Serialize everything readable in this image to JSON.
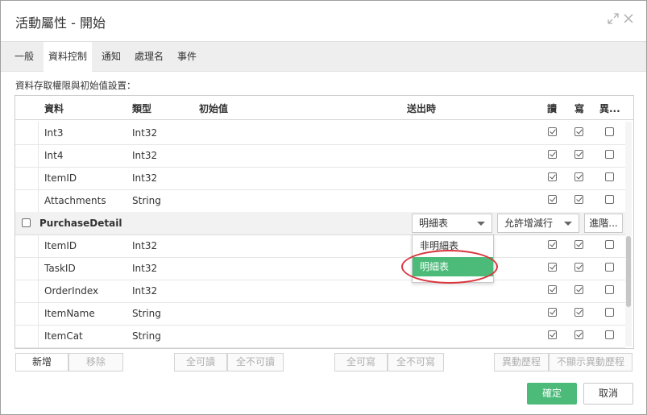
{
  "dialog": {
    "title": "活動屬性 - 開始"
  },
  "tabs": [
    {
      "label": "一般"
    },
    {
      "label": "資料控制"
    },
    {
      "label": "通知"
    },
    {
      "label": "處理名"
    },
    {
      "label": "事件"
    }
  ],
  "active_tab": "資料控制",
  "section_label": "資料存取權限與初始值設置：",
  "columns": {
    "data": "資料",
    "type": "類型",
    "initial": "初始值",
    "on_send": "送出時",
    "read": "讀",
    "write": "寫",
    "diff": "異..."
  },
  "rows_top": [
    {
      "name": "Int3",
      "type": "Int32",
      "read": true,
      "write": true,
      "diff": false
    },
    {
      "name": "Int4",
      "type": "Int32",
      "read": true,
      "write": true,
      "diff": false
    },
    {
      "name": "ItemID",
      "type": "Int32",
      "read": true,
      "write": true,
      "diff": false
    },
    {
      "name": "Attachments",
      "type": "String",
      "read": true,
      "write": true,
      "diff": false
    }
  ],
  "group": {
    "name": "PurchaseDetail",
    "checked": false,
    "table_mode": "明細表",
    "row_mode": "允許增減行",
    "advanced_label": "進階..."
  },
  "rows_group": [
    {
      "name": "ItemID",
      "type": "Int32",
      "read": true,
      "write": true,
      "diff": false
    },
    {
      "name": "TaskID",
      "type": "Int32",
      "read": true,
      "write": true,
      "diff": false
    },
    {
      "name": "OrderIndex",
      "type": "Int32",
      "read": true,
      "write": true,
      "diff": false
    },
    {
      "name": "ItemName",
      "type": "String",
      "read": true,
      "write": true,
      "diff": false
    },
    {
      "name": "ItemCat",
      "type": "String",
      "read": true,
      "write": true,
      "diff": false
    }
  ],
  "dropdown": {
    "options": [
      "非明細表",
      "明細表"
    ],
    "selected": "明細表"
  },
  "bottom_buttons": {
    "add": "新增",
    "remove": "移除",
    "all_readable": "全可讀",
    "none_readable": "全不可讀",
    "all_writable": "全可寫",
    "none_writable": "全不可寫",
    "diff_history": "異動歷程",
    "no_diff_history": "不顯示異動歷程"
  },
  "footer": {
    "ok": "確定",
    "cancel": "取消"
  },
  "colors": {
    "accent": "#4cbb7a",
    "highlight": "#d9363e"
  }
}
